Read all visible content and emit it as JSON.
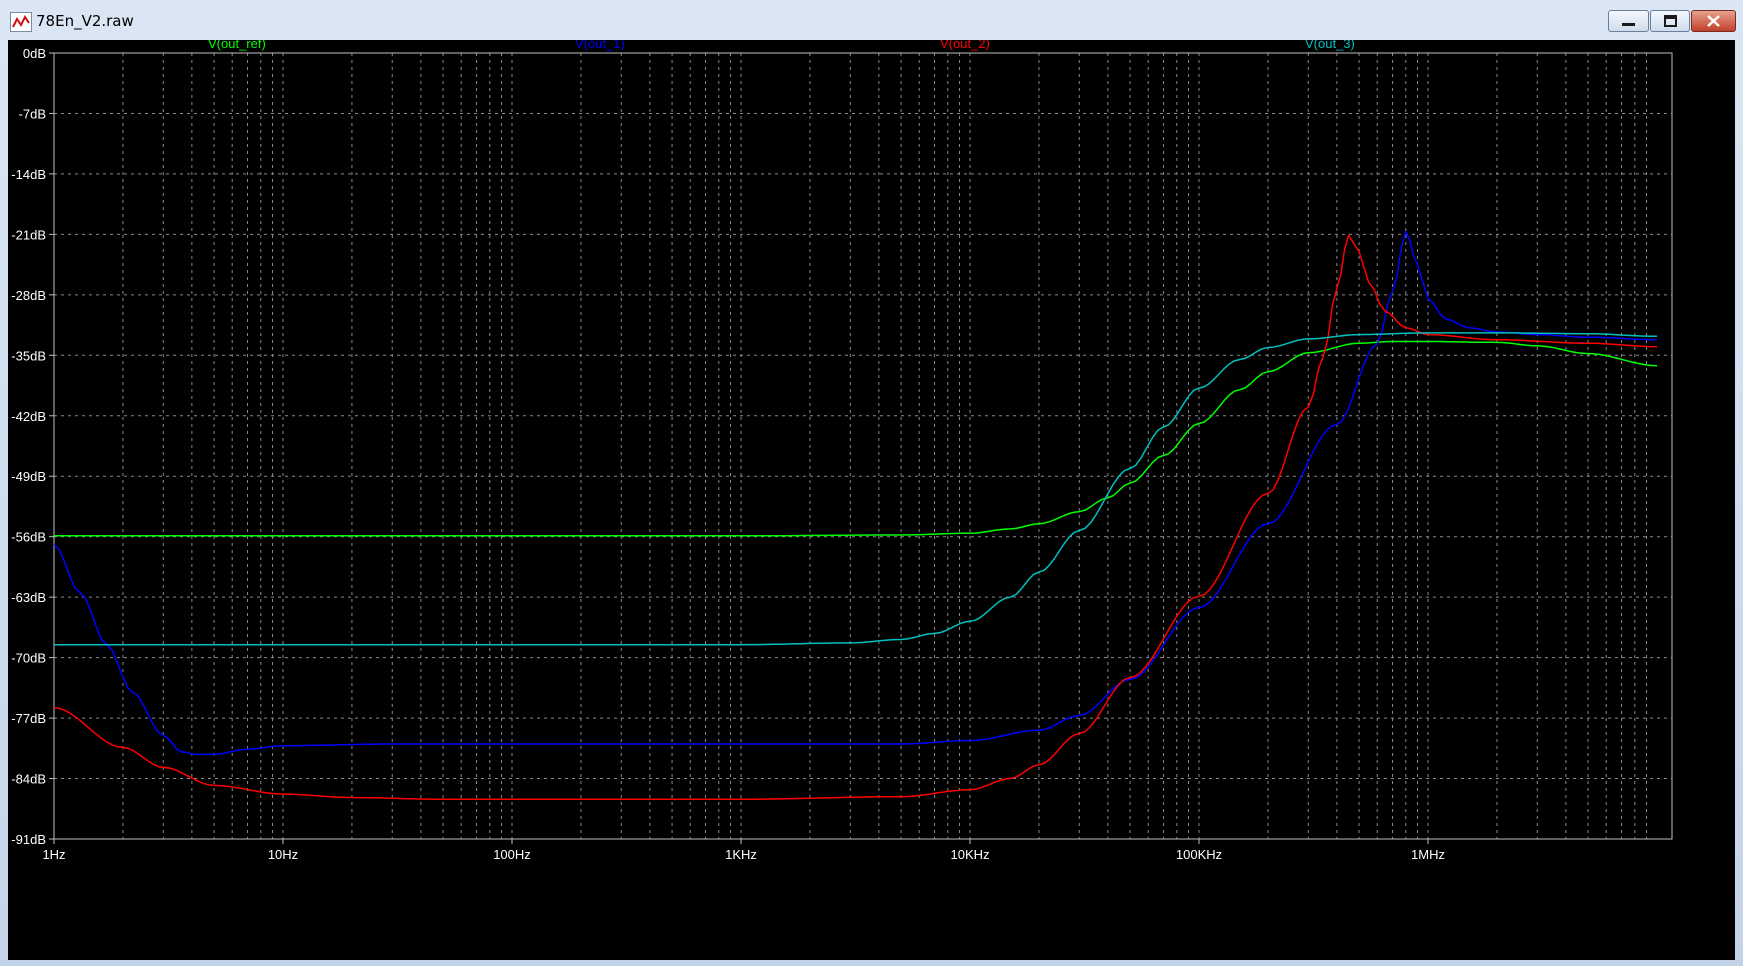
{
  "window": {
    "title": "78En_V2.raw",
    "icon": "waveform-icon",
    "controls": {
      "minimize_icon": "minimize-icon",
      "maximize_icon": "maximize-icon",
      "close_icon": "close-icon"
    }
  },
  "chart_data": {
    "type": "line",
    "title": "",
    "xlabel": "",
    "ylabel": "",
    "x_scale": "log",
    "xlim_hz": [
      1,
      10000000
    ],
    "ylim": [
      -91,
      0
    ],
    "grid": true,
    "legend": "top",
    "x_ticks": [
      {
        "value": 1,
        "label": "1Hz"
      },
      {
        "value": 10,
        "label": "10Hz"
      },
      {
        "value": 100,
        "label": "100Hz"
      },
      {
        "value": 1000,
        "label": "1KHz"
      },
      {
        "value": 10000,
        "label": "10KHz"
      },
      {
        "value": 100000,
        "label": "100KHz"
      },
      {
        "value": 1000000,
        "label": "1MHz"
      }
    ],
    "y_ticks": [
      {
        "value": 0,
        "label": "0dB"
      },
      {
        "value": -7,
        "label": "-7dB"
      },
      {
        "value": -14,
        "label": "-14dB"
      },
      {
        "value": -21,
        "label": "-21dB"
      },
      {
        "value": -28,
        "label": "-28dB"
      },
      {
        "value": -35,
        "label": "-35dB"
      },
      {
        "value": -42,
        "label": "-42dB"
      },
      {
        "value": -49,
        "label": "-49dB"
      },
      {
        "value": -56,
        "label": "-56dB"
      },
      {
        "value": -63,
        "label": "-63dB"
      },
      {
        "value": -70,
        "label": "-70dB"
      },
      {
        "value": -77,
        "label": "-77dB"
      },
      {
        "value": -84,
        "label": "-84dB"
      },
      {
        "value": -91,
        "label": "-91dB"
      }
    ],
    "colors": {
      "background": "#000000",
      "axis": "#c0c0c0",
      "grid": "#8a8a8a",
      "tick_text": "#ffffff"
    },
    "series": [
      {
        "name": "V(out_ref)",
        "color": "#00ff00",
        "points": [
          [
            1,
            -55.9
          ],
          [
            1000,
            -55.9
          ],
          [
            5000,
            -55.8
          ],
          [
            10000,
            -55.6
          ],
          [
            15000,
            -55.1
          ],
          [
            20000,
            -54.5
          ],
          [
            30000,
            -53.1
          ],
          [
            40000,
            -51.5
          ],
          [
            50000,
            -49.8
          ],
          [
            70000,
            -46.6
          ],
          [
            100000,
            -42.9
          ],
          [
            150000,
            -39.0
          ],
          [
            200000,
            -36.9
          ],
          [
            300000,
            -34.7
          ],
          [
            500000,
            -33.6
          ],
          [
            700000,
            -33.4
          ],
          [
            1000000,
            -33.4
          ],
          [
            2000000,
            -33.5
          ],
          [
            3000000,
            -33.9
          ],
          [
            5000000,
            -34.8
          ],
          [
            10000000,
            -36.2
          ]
        ]
      },
      {
        "name": "V(out_1)",
        "color": "#0000ff",
        "points": [
          [
            1,
            -56.9
          ],
          [
            1.3,
            -62.5
          ],
          [
            1.7,
            -68.5
          ],
          [
            2.2,
            -74.0
          ],
          [
            3,
            -79.0
          ],
          [
            3.6,
            -80.9
          ],
          [
            4.2,
            -81.2
          ],
          [
            5,
            -81.2
          ],
          [
            7,
            -80.6
          ],
          [
            10,
            -80.2
          ],
          [
            30,
            -80.0
          ],
          [
            1000,
            -80.0
          ],
          [
            5000,
            -80.0
          ],
          [
            10000,
            -79.6
          ],
          [
            20000,
            -78.4
          ],
          [
            30000,
            -76.7
          ],
          [
            50000,
            -72.5
          ],
          [
            100000,
            -64.2
          ],
          [
            200000,
            -54.5
          ],
          [
            400000,
            -43.0
          ],
          [
            600000,
            -33.7
          ],
          [
            700000,
            -27.6
          ],
          [
            800000,
            -20.7
          ],
          [
            900000,
            -24.5
          ],
          [
            1000000,
            -28.5
          ],
          [
            1200000,
            -30.8
          ],
          [
            1500000,
            -31.8
          ],
          [
            2000000,
            -32.3
          ],
          [
            3000000,
            -32.6
          ],
          [
            5000000,
            -32.9
          ],
          [
            10000000,
            -33.2
          ]
        ]
      },
      {
        "name": "V(out_2)",
        "color": "#ff0000",
        "points": [
          [
            1,
            -75.8
          ],
          [
            2,
            -80.4
          ],
          [
            3,
            -82.7
          ],
          [
            5,
            -84.8
          ],
          [
            10,
            -85.8
          ],
          [
            20,
            -86.2
          ],
          [
            50,
            -86.4
          ],
          [
            1000,
            -86.4
          ],
          [
            5000,
            -86.1
          ],
          [
            10000,
            -85.3
          ],
          [
            15000,
            -84.0
          ],
          [
            20000,
            -82.4
          ],
          [
            30000,
            -78.8
          ],
          [
            50000,
            -72.3
          ],
          [
            100000,
            -62.9
          ],
          [
            200000,
            -51.0
          ],
          [
            300000,
            -41.0
          ],
          [
            350000,
            -35.0
          ],
          [
            400000,
            -27.2
          ],
          [
            450000,
            -21.1
          ],
          [
            500000,
            -23.0
          ],
          [
            550000,
            -26.5
          ],
          [
            650000,
            -29.9
          ],
          [
            800000,
            -31.8
          ],
          [
            1000000,
            -32.6
          ],
          [
            2000000,
            -33.2
          ],
          [
            5000000,
            -33.6
          ],
          [
            10000000,
            -34.0
          ]
        ]
      },
      {
        "name": "V(out_3)",
        "color": "#00c0c0",
        "points": [
          [
            1,
            -68.5
          ],
          [
            100,
            -68.5
          ],
          [
            1000,
            -68.5
          ],
          [
            3000,
            -68.3
          ],
          [
            5000,
            -67.9
          ],
          [
            7000,
            -67.2
          ],
          [
            10000,
            -65.8
          ],
          [
            15000,
            -63.0
          ],
          [
            20000,
            -60.1
          ],
          [
            30000,
            -55.3
          ],
          [
            50000,
            -48.1
          ],
          [
            70000,
            -43.3
          ],
          [
            100000,
            -38.8
          ],
          [
            150000,
            -35.5
          ],
          [
            200000,
            -34.1
          ],
          [
            300000,
            -33.1
          ],
          [
            500000,
            -32.6
          ],
          [
            1000000,
            -32.4
          ],
          [
            2000000,
            -32.4
          ],
          [
            5000000,
            -32.5
          ],
          [
            10000000,
            -32.8
          ]
        ]
      }
    ]
  }
}
